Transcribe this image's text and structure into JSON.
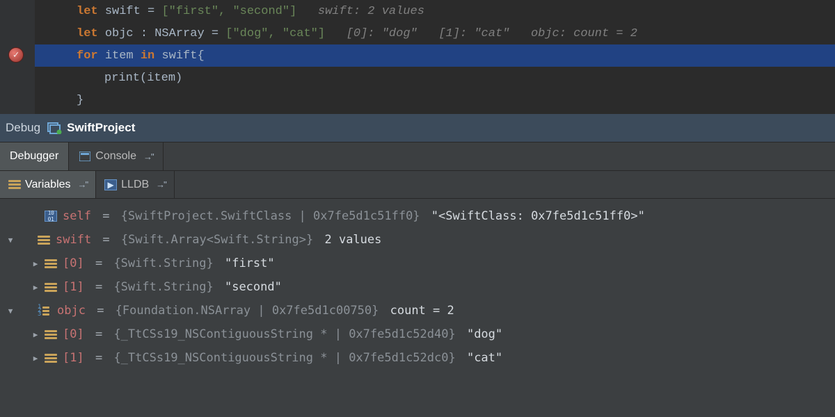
{
  "code": {
    "line1": {
      "kw1": "let",
      "id": "swift",
      "eq": "=",
      "str": "[\"first\", \"second\"]",
      "comment": "swift: 2 values"
    },
    "line2": {
      "kw1": "let",
      "id": "objc",
      "colon": ":",
      "type": "NSArray",
      "eq": "=",
      "str": "[\"dog\", \"cat\"]",
      "comment": "[0]: \"dog\"   [1]: \"cat\"   objc: count = 2"
    },
    "line3": {
      "kw1": "for",
      "id": "item",
      "kw2": "in",
      "coll": "swift",
      "brace": "{"
    },
    "line4": {
      "call": "print",
      "args": "(item)"
    },
    "line5": {
      "brace": "}"
    }
  },
  "debug": {
    "label": "Debug",
    "project": "SwiftProject"
  },
  "tabs": {
    "debugger": "Debugger",
    "console": "Console"
  },
  "subtabs": {
    "variables": "Variables",
    "lldb": "LLDB"
  },
  "vars": {
    "self": {
      "name": "self",
      "eq": " = ",
      "type": "{SwiftProject.SwiftClass | 0x7fe5d1c51ff0}",
      "val": " \"<SwiftClass: 0x7fe5d1c51ff0>\""
    },
    "swift": {
      "name": "swift",
      "eq": " = ",
      "type": "{Swift.Array<Swift.String>}",
      "val": " 2 values",
      "children": [
        {
          "name": "[0]",
          "eq": " = ",
          "type": "{Swift.String}",
          "val": " \"first\""
        },
        {
          "name": "[1]",
          "eq": " = ",
          "type": "{Swift.String}",
          "val": " \"second\""
        }
      ]
    },
    "objc": {
      "name": "objc",
      "eq": " = ",
      "type": "{Foundation.NSArray | 0x7fe5d1c00750}",
      "val": " count = 2",
      "children": [
        {
          "name": "[0]",
          "eq": " = ",
          "type": "{_TtCSs19_NSContiguousString * | 0x7fe5d1c52d40}",
          "val": " \"dog\""
        },
        {
          "name": "[1]",
          "eq": " = ",
          "type": "{_TtCSs19_NSContiguousString * | 0x7fe5d1c52dc0}",
          "val": " \"cat\""
        }
      ]
    }
  }
}
